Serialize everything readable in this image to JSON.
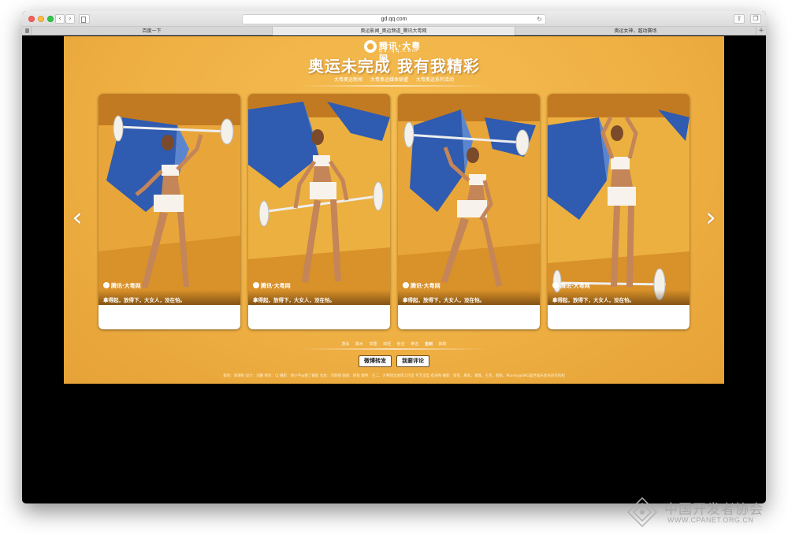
{
  "browser": {
    "url": "gd.qq.com",
    "tabs": [
      {
        "label": "百度一下",
        "active": false
      },
      {
        "label": "奥运影闻_奥运频道_腾讯大粤网",
        "active": true
      },
      {
        "label": "奥运女神，越动赛场",
        "active": false
      }
    ]
  },
  "page": {
    "logo_text": "腾讯·大粤网",
    "logo_sub": "gd.qq.com",
    "headline": "奥运未完成 我有我精彩",
    "subnav": [
      "大粤奥运新闻",
      "大粤奥运媒体联盟",
      "大粤奥运系列活动"
    ],
    "cards": [
      {
        "watermark": "腾讯·大粤网",
        "caption": "拿得起，放得下，大女人，没在怕。"
      },
      {
        "watermark": "腾讯·大粤网",
        "caption": "拿得起，放得下，大女人，没在怕。"
      },
      {
        "watermark": "腾讯·大粤网",
        "caption": "拿得起，放得下，大女人，没在怕。"
      },
      {
        "watermark": "腾讯·大粤网",
        "caption": "拿得起，放得下，大女人，没在怕。"
      }
    ],
    "prev_arrow": "‹",
    "next_arrow": "›",
    "thumbs": [
      "游泳",
      "跳水",
      "举重",
      "田径",
      "射击",
      "拳击",
      "击剑",
      "摔跤"
    ],
    "selected_thumb": 6,
    "share_button": "微博转发",
    "comment_button": "我要评论",
    "credits": "策划：郑潮钊  设计：刘鹏  制作：CJ 摄影：谢小宇@隆丁摄影 化妆：刘新楠  图库：邢程  模特：王二、大粤网沈逸瑶工作室 专艺造型 崔海燕 摄影：梁苗、麻彩、潘瑜、王杰、程帆、Mandy@SNG盛世娱乐星光创作机构"
  },
  "footer": {
    "org_name": "中国开发者协会",
    "org_url": "WWW.CPANET.ORG.CN"
  }
}
